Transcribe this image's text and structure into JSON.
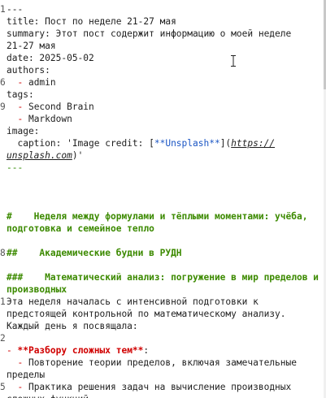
{
  "editor": {
    "lines": [
      {
        "n": "1",
        "parts": [
          {
            "t": "---",
            "c": "c-fm"
          }
        ]
      },
      {
        "n": "",
        "parts": [
          {
            "t": "title: Пост по неделе 21-27 мая",
            "c": "c-fm"
          }
        ]
      },
      {
        "n": "",
        "parts": [
          {
            "t": "summary: Этот пост содержит информацию о моей неделе",
            "c": "c-fm"
          }
        ]
      },
      {
        "n": "",
        "parts": [
          {
            "t": "21-27 мая",
            "c": "c-fm"
          }
        ]
      },
      {
        "n": "",
        "parts": [
          {
            "t": "date: 2025-05-02",
            "c": "c-fm"
          }
        ]
      },
      {
        "n": "",
        "parts": [
          {
            "t": "authors:",
            "c": "c-fm"
          }
        ]
      },
      {
        "n": "6",
        "parts": [
          {
            "t": "  - ",
            "c": "c-red"
          },
          {
            "t": "admin",
            "c": "c-fm"
          }
        ]
      },
      {
        "n": "",
        "parts": [
          {
            "t": "tags:",
            "c": "c-fm"
          }
        ]
      },
      {
        "n": "9",
        "parts": [
          {
            "t": "  - ",
            "c": "c-red"
          },
          {
            "t": "Second Brain",
            "c": "c-fm"
          }
        ]
      },
      {
        "n": "",
        "parts": [
          {
            "t": "  - ",
            "c": "c-red"
          },
          {
            "t": "Markdown",
            "c": "c-fm"
          }
        ]
      },
      {
        "n": "",
        "parts": [
          {
            "t": "image:",
            "c": "c-fm"
          }
        ]
      },
      {
        "n": "",
        "parts": [
          {
            "t": "  caption: 'Image credit: [",
            "c": "c-fm"
          },
          {
            "t": "**Unsplash**",
            "c": "c-blue"
          },
          {
            "t": "](",
            "c": "c-fm"
          },
          {
            "t": "https://",
            "c": "c-url"
          }
        ]
      },
      {
        "n": "",
        "parts": [
          {
            "t": "unsplash.com",
            "c": "c-url"
          },
          {
            "t": ")'",
            "c": "c-fm"
          }
        ]
      },
      {
        "n": "",
        "parts": [
          {
            "t": "---",
            "c": "c-dash"
          }
        ]
      },
      {
        "n": "",
        "parts": []
      },
      {
        "n": "",
        "parts": []
      },
      {
        "n": "",
        "parts": []
      },
      {
        "n": "",
        "parts": [
          {
            "t": "#    Неделя между формулами и тёплыми моментами: учёба,",
            "c": "c-green"
          }
        ]
      },
      {
        "n": "",
        "parts": [
          {
            "t": "подготовка и семейное тепло",
            "c": "c-green"
          }
        ]
      },
      {
        "n": "",
        "parts": []
      },
      {
        "n": "8",
        "parts": [
          {
            "t": "##    Академические будни в РУДН",
            "c": "c-green"
          }
        ]
      },
      {
        "n": "",
        "parts": []
      },
      {
        "n": "",
        "parts": [
          {
            "t": "###    Математический анализ: погружение в мир пределов и",
            "c": "c-green"
          }
        ]
      },
      {
        "n": "",
        "parts": [
          {
            "t": "производных",
            "c": "c-green"
          }
        ]
      },
      {
        "n": "1",
        "parts": [
          {
            "t": "Эта неделя началась с интенсивной подготовки к",
            "c": "c-fm"
          }
        ]
      },
      {
        "n": "",
        "parts": [
          {
            "t": "предстоящей контрольной по математическому анализу.",
            "c": "c-fm"
          }
        ]
      },
      {
        "n": "",
        "parts": [
          {
            "t": "Каждый день я посвящала:",
            "c": "c-fm"
          }
        ]
      },
      {
        "n": "2",
        "parts": []
      },
      {
        "n": "",
        "parts": [
          {
            "t": "- ",
            "c": "c-red"
          },
          {
            "t": "**Разбору сложных тем**",
            "c": "c-bold-red"
          },
          {
            "t": ":",
            "c": "c-fm"
          }
        ]
      },
      {
        "n": "",
        "parts": [
          {
            "t": "  - ",
            "c": "c-red"
          },
          {
            "t": "Повторение теории пределов, включая замечательные",
            "c": "c-fm"
          }
        ]
      },
      {
        "n": "",
        "parts": [
          {
            "t": "пределы",
            "c": "c-fm"
          }
        ]
      },
      {
        "n": "5",
        "parts": [
          {
            "t": "  - ",
            "c": "c-red"
          },
          {
            "t": "Практика решения задач на вычисление производных",
            "c": "c-fm"
          }
        ]
      },
      {
        "n": "",
        "parts": [
          {
            "t": "сложных функций",
            "c": "c-fm"
          }
        ]
      }
    ]
  },
  "icons": {
    "cursor": "text-cursor-icon"
  }
}
